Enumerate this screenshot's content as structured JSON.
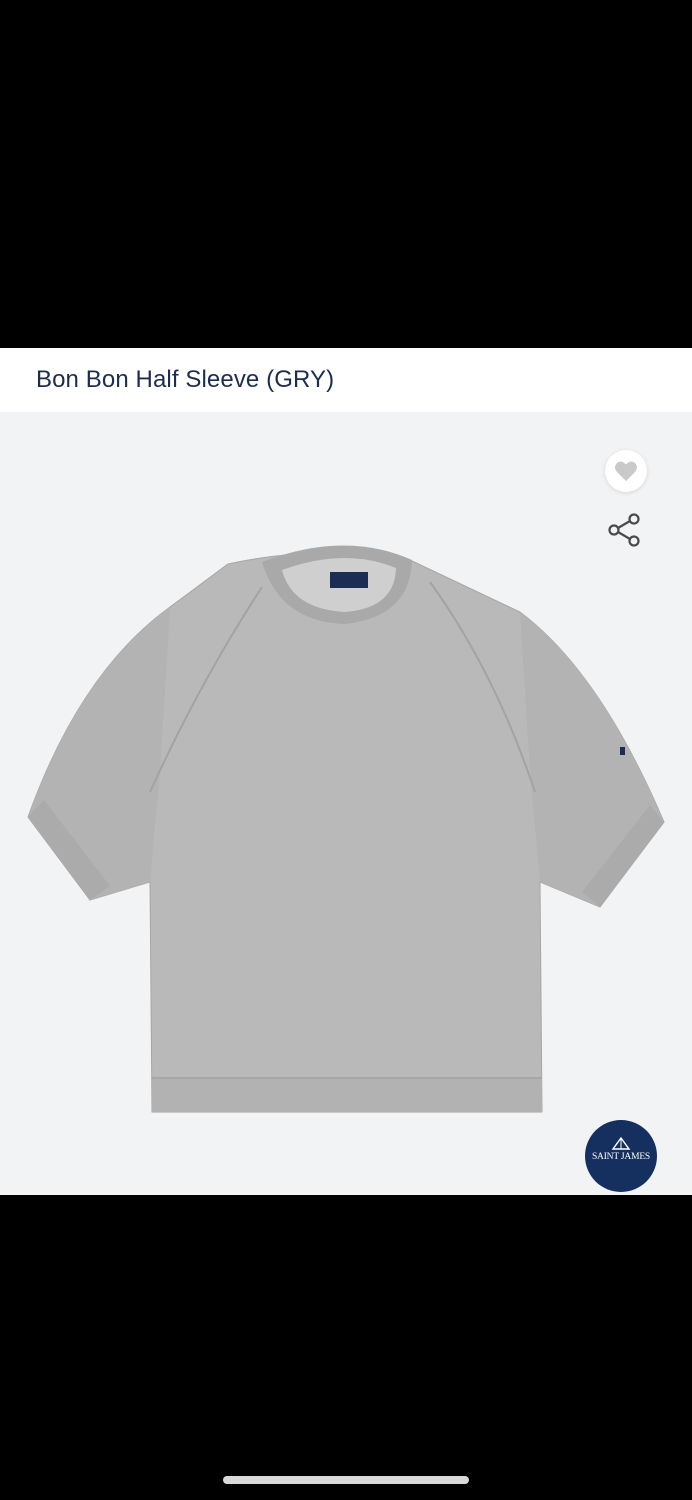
{
  "product": {
    "title": "Bon Bon Half Sleeve (GRY)"
  },
  "image": {
    "background_color": "#f2f3f5",
    "garment_color": "#b9b9b9",
    "brand_logo_text": "SAINT JAMES"
  },
  "actions": {
    "wishlist_icon": "heart-icon",
    "share_icon": "share-icon"
  },
  "colors": {
    "title_text": "#1c2e4a",
    "logo_background": "#15305f"
  }
}
